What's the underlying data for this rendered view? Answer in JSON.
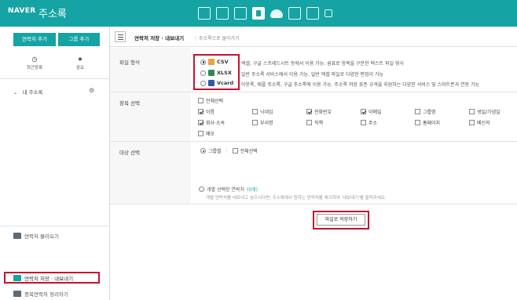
{
  "header": {
    "brand": "NAVER",
    "title": "주소록",
    "apps": [
      {
        "icon": "mail-icon"
      },
      {
        "icon": "calendar-icon"
      },
      {
        "icon": "list-icon"
      },
      {
        "icon": "contacts-icon",
        "active": true
      },
      {
        "icon": "cloud-icon"
      },
      {
        "icon": "memo-icon"
      },
      {
        "icon": "home-icon"
      },
      {
        "icon": "square-icon"
      }
    ]
  },
  "sidebar": {
    "add_contact": "연락처 추가",
    "add_group": "그룹 추가",
    "recent_label": "최근등록",
    "important_label": "중요",
    "my_addressbook": "내 주소록",
    "menu": [
      {
        "label": "연락처 불러오기"
      },
      {
        "label": "연락처 저장 · 내보내기",
        "active": true
      },
      {
        "label": "중복연락처 정리하기"
      }
    ]
  },
  "main": {
    "title": "연락처 저장 · 내보내기",
    "back_link": "주소록으로 돌아가기",
    "file_format_label": "파일 형식",
    "formats": [
      {
        "name": "CSV",
        "color": "#e8a33c",
        "selected": true,
        "desc": "엑셀, 구글 스프레드시트 등에서 이용 가능. 쉼표로 항목을 구분한 텍스트 파일 형식"
      },
      {
        "name": "XLSX",
        "color": "#2e8b57",
        "selected": false,
        "desc": "일반 주소록 서비스에서 이용 가능. 일반 엑셀 파일로 다양한 편집이 가능"
      },
      {
        "name": "Vcard",
        "color": "#2a5aa8",
        "selected": false,
        "desc": "아웃룩, 애플 주소록, 구글 주소록에 이용 가능. 주소록 저장 표준 규격을 지원하는 다양한 서비스 및 스마트폰과 연동 가능"
      }
    ],
    "item_select_label": "항목 선택",
    "select_all": "전체선택",
    "fields": [
      {
        "label": "이름",
        "checked": true
      },
      {
        "label": "닉네임",
        "checked": false
      },
      {
        "label": "전화번호",
        "checked": true
      },
      {
        "label": "이메일",
        "checked": true
      },
      {
        "label": "그룹명",
        "checked": false
      },
      {
        "label": "생일/기념일",
        "checked": false
      },
      {
        "label": "회사·소속",
        "checked": true
      },
      {
        "label": "부서명",
        "checked": false
      },
      {
        "label": "직책",
        "checked": false
      },
      {
        "label": "주소",
        "checked": false
      },
      {
        "label": "홈페이지",
        "checked": false
      },
      {
        "label": "메신저",
        "checked": false
      },
      {
        "label": "메모",
        "checked": false
      }
    ],
    "target_label": "대상 선택",
    "target_group": "그룹별",
    "target_all": "전체선택",
    "individual_label": "개별 선택한 연락처",
    "individual_count": "(0개)",
    "individual_note": "개별 연락처를 내보내고 싶으시다면, 주소록에서 원하는 연락처를 체크하여 '내보내기'를 클릭하세요.",
    "save_button": "파일로 저장하기"
  },
  "colors": {
    "brand": "#16a3a3",
    "highlight": "#c8102e"
  }
}
